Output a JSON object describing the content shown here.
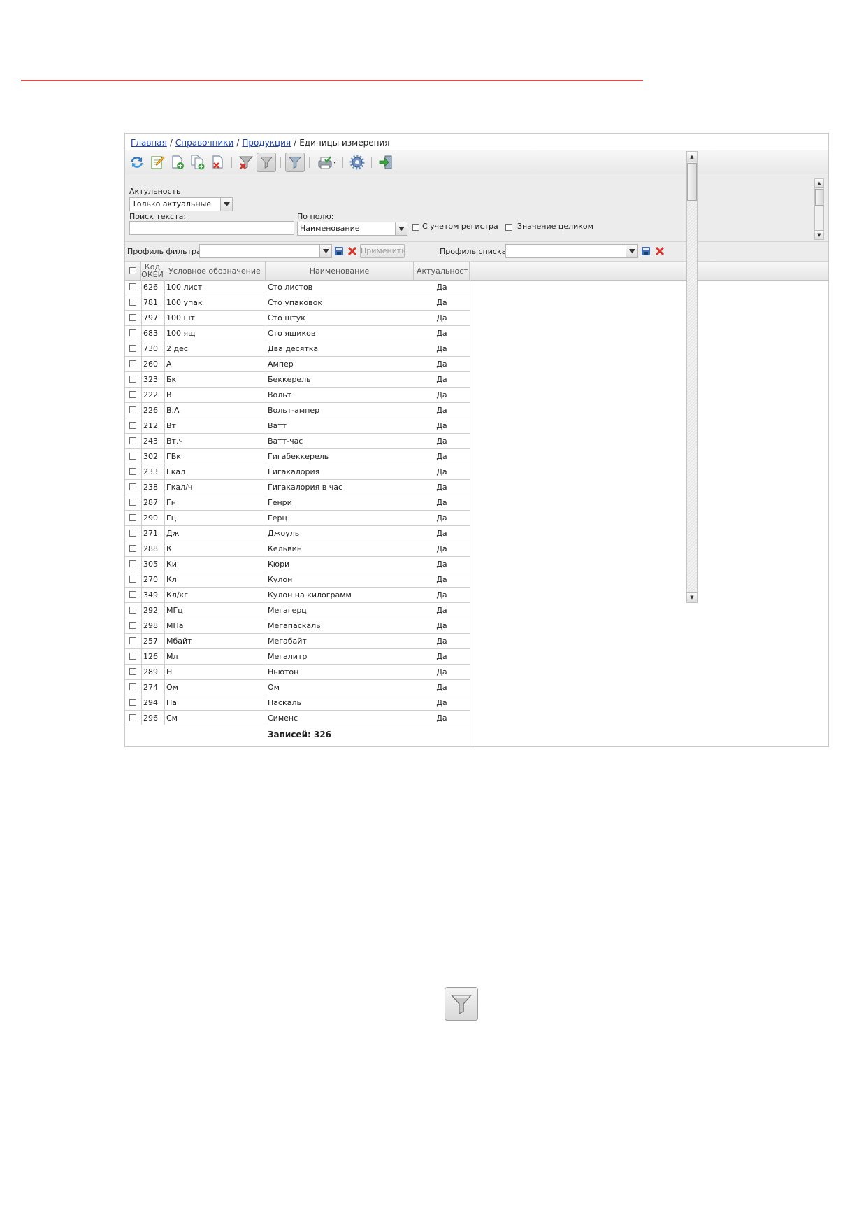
{
  "breadcrumb": {
    "items": [
      "Главная",
      "Справочники",
      "Продукция"
    ],
    "current": "Единицы измерения",
    "separator": "/"
  },
  "toolbar": {
    "buttons": [
      {
        "icon": "refresh-icon"
      },
      {
        "icon": "edit-icon"
      },
      {
        "icon": "add-icon"
      },
      {
        "icon": "copy-icon"
      },
      {
        "icon": "delete-icon"
      },
      {
        "icon": "clear-filter-icon"
      },
      {
        "icon": "filter-icon"
      },
      {
        "icon": "filter-toggle-icon"
      },
      {
        "icon": "print-icon"
      },
      {
        "icon": "settings-icon"
      },
      {
        "icon": "exit-icon"
      }
    ]
  },
  "filter_panel": {
    "actuality_label": "Актульность",
    "actuality_value": "Только актуальные",
    "search_label": "Поиск текста:",
    "search_value": "",
    "field_label": "По полю:",
    "field_value": "Наименование",
    "case_label": "С учетом регистра",
    "case_checked": false,
    "whole_label": "Значение целиком",
    "whole_checked": false
  },
  "profile_bar": {
    "filter_profile_label": "Профиль фильтра",
    "filter_profile_value": "",
    "apply_label": "Применить",
    "list_profile_label": "Профиль списка",
    "list_profile_value": ""
  },
  "grid": {
    "columns": [
      "Код ОКЕИ",
      "Условное обозначение",
      "Наименование",
      "Актуальность"
    ],
    "header_display": [
      "Код ОКЕИ",
      "Условное обозначение",
      "Наименование",
      "Актуальност"
    ],
    "rows": [
      {
        "code": "626",
        "symbol": "100 лист",
        "name": "Сто листов",
        "actual": "Да"
      },
      {
        "code": "781",
        "symbol": "100 упак",
        "name": "Сто упаковок",
        "actual": "Да"
      },
      {
        "code": "797",
        "symbol": "100 шт",
        "name": "Сто штук",
        "actual": "Да"
      },
      {
        "code": "683",
        "symbol": "100 ящ",
        "name": "Сто ящиков",
        "actual": "Да"
      },
      {
        "code": "730",
        "symbol": "2 дес",
        "name": "Два десятка",
        "actual": "Да"
      },
      {
        "code": "260",
        "symbol": "А",
        "name": "Ампер",
        "actual": "Да"
      },
      {
        "code": "323",
        "symbol": "Бк",
        "name": "Беккерель",
        "actual": "Да"
      },
      {
        "code": "222",
        "symbol": "В",
        "name": "Вольт",
        "actual": "Да"
      },
      {
        "code": "226",
        "symbol": "В.А",
        "name": "Вольт-ампер",
        "actual": "Да"
      },
      {
        "code": "212",
        "symbol": "Вт",
        "name": "Ватт",
        "actual": "Да"
      },
      {
        "code": "243",
        "symbol": "Вт.ч",
        "name": "Ватт-час",
        "actual": "Да"
      },
      {
        "code": "302",
        "symbol": "ГБк",
        "name": "Гигабеккерель",
        "actual": "Да"
      },
      {
        "code": "233",
        "symbol": "Гкал",
        "name": "Гигакалория",
        "actual": "Да"
      },
      {
        "code": "238",
        "symbol": "Гкал/ч",
        "name": "Гигакалория в час",
        "actual": "Да"
      },
      {
        "code": "287",
        "symbol": "Гн",
        "name": "Генри",
        "actual": "Да"
      },
      {
        "code": "290",
        "symbol": "Гц",
        "name": "Герц",
        "actual": "Да"
      },
      {
        "code": "271",
        "symbol": "Дж",
        "name": "Джоуль",
        "actual": "Да"
      },
      {
        "code": "288",
        "symbol": "К",
        "name": "Кельвин",
        "actual": "Да"
      },
      {
        "code": "305",
        "symbol": "Ки",
        "name": "Кюри",
        "actual": "Да"
      },
      {
        "code": "270",
        "symbol": "Кл",
        "name": "Кулон",
        "actual": "Да"
      },
      {
        "code": "349",
        "symbol": "Кл/кг",
        "name": "Кулон на килограмм",
        "actual": "Да"
      },
      {
        "code": "292",
        "symbol": "МГц",
        "name": "Мегагерц",
        "actual": "Да"
      },
      {
        "code": "298",
        "symbol": "МПа",
        "name": "Мегапаскаль",
        "actual": "Да"
      },
      {
        "code": "257",
        "symbol": "Мбайт",
        "name": "Мегабайт",
        "actual": "Да"
      },
      {
        "code": "126",
        "symbol": "Мл",
        "name": "Мегалитр",
        "actual": "Да"
      },
      {
        "code": "289",
        "symbol": "Н",
        "name": "Ньютон",
        "actual": "Да"
      },
      {
        "code": "274",
        "symbol": "Ом",
        "name": "Ом",
        "actual": "Да"
      },
      {
        "code": "294",
        "symbol": "Па",
        "name": "Паскаль",
        "actual": "Да"
      },
      {
        "code": "296",
        "symbol": "См",
        "name": "Сименс",
        "actual": "Да"
      }
    ],
    "footer": "Записей: 326"
  },
  "standalone_icon": {
    "icon": "filter-icon"
  },
  "colors": {
    "rule": "#e04b4b",
    "link": "#1a3fb5",
    "delete_red": "#d9342b",
    "save_blue": "#3d6fb6"
  }
}
